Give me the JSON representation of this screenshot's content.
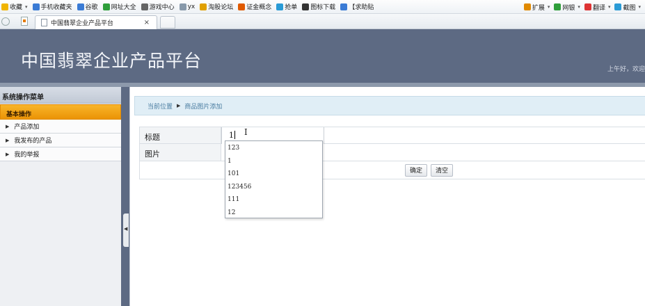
{
  "favorites_bar": {
    "items": [
      {
        "label": "收藏",
        "icon": "star-icon",
        "color": "#f0b400"
      },
      {
        "label": "手机收藏夹",
        "icon": "phone-icon",
        "color": "#3a7bd5"
      },
      {
        "label": "谷歌",
        "icon": "google-icon",
        "color": "#3a7bd5"
      },
      {
        "label": "网址大全",
        "icon": "globe-icon",
        "color": "#2e9e3a"
      },
      {
        "label": "游戏中心",
        "icon": "gamepad-icon",
        "color": "#666666"
      },
      {
        "label": "yx",
        "icon": "page-icon",
        "color": "#8899aa"
      },
      {
        "label": "淘股论坛",
        "icon": "spark-icon",
        "color": "#e0a000"
      },
      {
        "label": "证金概念",
        "icon": "flame-icon",
        "color": "#e05a00"
      },
      {
        "label": "抢单",
        "icon": "arrow-icon",
        "color": "#2a9bd6"
      },
      {
        "label": "图标下载",
        "icon": "bookmark-icon",
        "color": "#333333"
      },
      {
        "label": "【求助贴",
        "icon": "image-icon",
        "color": "#3a7bd5"
      }
    ],
    "right_items": [
      {
        "label": "扩展",
        "icon": "grid-icon",
        "color": "#e08a00"
      },
      {
        "label": "网银",
        "icon": "bank-icon",
        "color": "#2e9e3a"
      },
      {
        "label": "翻译",
        "icon": "translate-icon",
        "color": "#d33"
      },
      {
        "label": "截图",
        "icon": "scissors-icon",
        "color": "#2a9bd6"
      }
    ]
  },
  "tab": {
    "title": "中国翡翠企业产品平台",
    "close": "×"
  },
  "header": {
    "site_title": "中国翡翠企业产品平台",
    "greeting": "上午好，欢迎"
  },
  "sidebar": {
    "title": "系统操作菜单",
    "group": "基本操作",
    "items": [
      {
        "label": "产品添加"
      },
      {
        "label": "我发布的产品"
      },
      {
        "label": "我的举报"
      }
    ]
  },
  "breadcrumb": {
    "current_label": "当前位置",
    "page": "商品图片添加"
  },
  "form": {
    "title_label": "标题",
    "title_value": "1",
    "image_label": "图片",
    "submit": "确定",
    "clear": "清空"
  },
  "autocomplete": {
    "options": [
      "123",
      "1",
      "101",
      "123456",
      "111",
      "12"
    ]
  }
}
